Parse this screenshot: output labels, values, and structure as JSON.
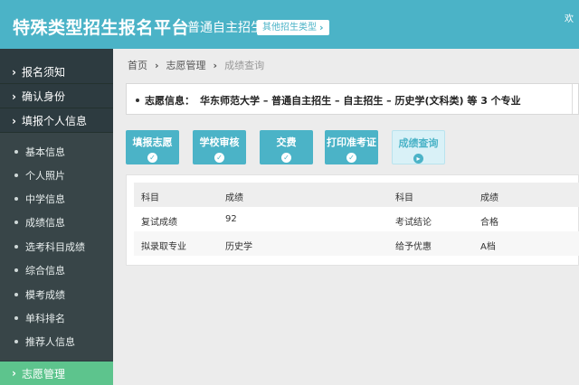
{
  "header": {
    "title": "特殊类型招生报名平台",
    "subtitle": "普通自主招生",
    "type_button": "其他招生类型",
    "corner_text": "欢"
  },
  "sidebar": {
    "top_items": [
      "报名须知",
      "确认身份",
      "填报个人信息"
    ],
    "sub_items": [
      "基本信息",
      "个人照片",
      "中学信息",
      "成绩信息",
      "选考科目成绩",
      "综合信息",
      "模考成绩",
      "单科排名",
      "推荐人信息"
    ],
    "active_item": "志愿管理"
  },
  "breadcrumb": [
    "首页",
    "志愿管理",
    "成绩查询"
  ],
  "info": {
    "label": "志愿信息：",
    "value": "华东师范大学 – 普通自主招生 – 自主招生 – 历史学(文科类) 等 3 个专业"
  },
  "steps": [
    {
      "label": "填报志愿",
      "state": "done"
    },
    {
      "label": "学校审核",
      "state": "done"
    },
    {
      "label": "交费",
      "state": "done"
    },
    {
      "label": "打印准考证",
      "state": "done"
    },
    {
      "label": "成绩查询",
      "state": "current"
    }
  ],
  "table": {
    "headers": [
      "科目",
      "成绩",
      "科目",
      "成绩"
    ],
    "rows": [
      [
        "复试成绩",
        "92",
        "考试结论",
        "合格"
      ],
      [
        "拟录取专业",
        "历史学",
        "给予优惠",
        "A档"
      ]
    ]
  },
  "colors": {
    "accent": "#4bb3c7",
    "active_nav": "#5dc48d",
    "sidebar": "#2d3b40"
  }
}
